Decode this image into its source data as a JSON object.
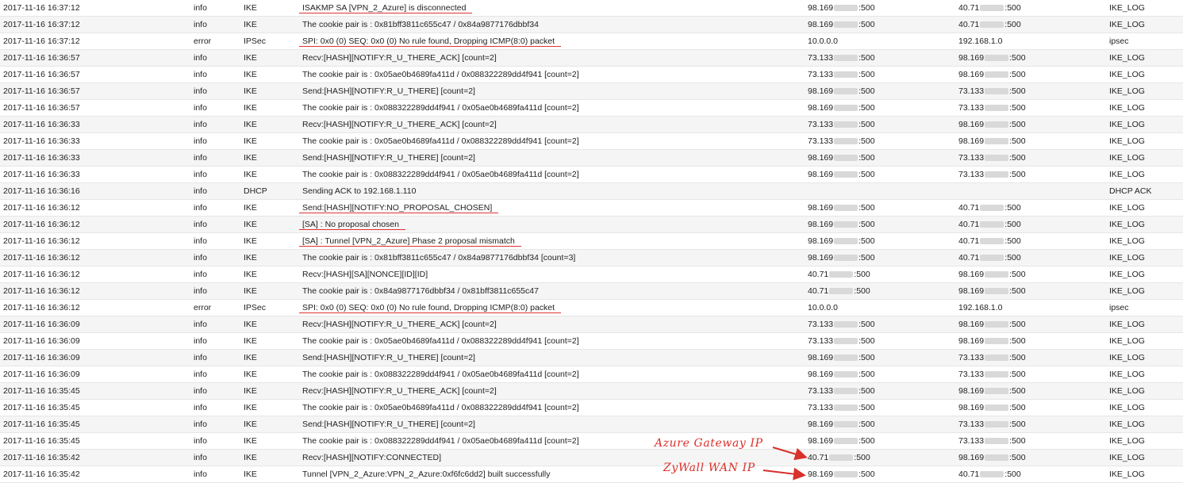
{
  "colors": {
    "annotation": "#d9302b",
    "row_alt": "#f5f5f5",
    "text": "#222222"
  },
  "rows": [
    {
      "time": "2017-11-16 16:37:12",
      "priority": "info",
      "category": "IKE",
      "message": "ISAKMP SA [VPN_2_Azure] is disconnected",
      "src": [
        "98.169",
        "",
        ":500"
      ],
      "dst": [
        "40.71",
        "",
        ":500"
      ],
      "note": "IKE_LOG",
      "underlined": true
    },
    {
      "time": "2017-11-16 16:37:12",
      "priority": "info",
      "category": "IKE",
      "message": "The cookie pair is : 0x81bff3811c655c47 / 0x84a9877176dbbf34",
      "src": [
        "98.169",
        "",
        ":500"
      ],
      "dst": [
        "40.71",
        "",
        ":500"
      ],
      "note": "IKE_LOG",
      "underlined": false
    },
    {
      "time": "2017-11-16 16:37:12",
      "priority": "error",
      "category": "IPSec",
      "message": "SPI: 0x0 (0) SEQ: 0x0 (0) No rule found, Dropping ICMP(8:0) packet",
      "src": [
        "10.0.0.0",
        "",
        ""
      ],
      "dst": [
        "192.168.1.0",
        "",
        ""
      ],
      "note": "ipsec",
      "underlined": true
    },
    {
      "time": "2017-11-16 16:36:57",
      "priority": "info",
      "category": "IKE",
      "message": "Recv:[HASH][NOTIFY:R_U_THERE_ACK] [count=2]",
      "src": [
        "73.133",
        "",
        ":500"
      ],
      "dst": [
        "98.169",
        "",
        ":500"
      ],
      "note": "IKE_LOG",
      "underlined": false
    },
    {
      "time": "2017-11-16 16:36:57",
      "priority": "info",
      "category": "IKE",
      "message": "The cookie pair is : 0x05ae0b4689fa411d / 0x088322289dd4f941 [count=2]",
      "src": [
        "73.133",
        "",
        ":500"
      ],
      "dst": [
        "98.169",
        "",
        ":500"
      ],
      "note": "IKE_LOG",
      "underlined": false
    },
    {
      "time": "2017-11-16 16:36:57",
      "priority": "info",
      "category": "IKE",
      "message": "Send:[HASH][NOTIFY:R_U_THERE] [count=2]",
      "src": [
        "98.169",
        "",
        ":500"
      ],
      "dst": [
        "73.133",
        "",
        ":500"
      ],
      "note": "IKE_LOG",
      "underlined": false
    },
    {
      "time": "2017-11-16 16:36:57",
      "priority": "info",
      "category": "IKE",
      "message": "The cookie pair is : 0x088322289dd4f941 / 0x05ae0b4689fa411d [count=2]",
      "src": [
        "98.169",
        "",
        ":500"
      ],
      "dst": [
        "73.133",
        "",
        ":500"
      ],
      "note": "IKE_LOG",
      "underlined": false
    },
    {
      "time": "2017-11-16 16:36:33",
      "priority": "info",
      "category": "IKE",
      "message": "Recv:[HASH][NOTIFY:R_U_THERE_ACK] [count=2]",
      "src": [
        "73.133",
        "",
        ":500"
      ],
      "dst": [
        "98.169",
        "",
        ":500"
      ],
      "note": "IKE_LOG",
      "underlined": false
    },
    {
      "time": "2017-11-16 16:36:33",
      "priority": "info",
      "category": "IKE",
      "message": "The cookie pair is : 0x05ae0b4689fa411d / 0x088322289dd4f941 [count=2]",
      "src": [
        "73.133",
        "",
        ":500"
      ],
      "dst": [
        "98.169",
        "",
        ":500"
      ],
      "note": "IKE_LOG",
      "underlined": false
    },
    {
      "time": "2017-11-16 16:36:33",
      "priority": "info",
      "category": "IKE",
      "message": "Send:[HASH][NOTIFY:R_U_THERE] [count=2]",
      "src": [
        "98.169",
        "",
        ":500"
      ],
      "dst": [
        "73.133",
        "",
        ":500"
      ],
      "note": "IKE_LOG",
      "underlined": false
    },
    {
      "time": "2017-11-16 16:36:33",
      "priority": "info",
      "category": "IKE",
      "message": "The cookie pair is : 0x088322289dd4f941 / 0x05ae0b4689fa411d [count=2]",
      "src": [
        "98.169",
        "",
        ":500"
      ],
      "dst": [
        "73.133",
        "",
        ":500"
      ],
      "note": "IKE_LOG",
      "underlined": false
    },
    {
      "time": "2017-11-16 16:36:16",
      "priority": "info",
      "category": "DHCP",
      "message": "Sending ACK to 192.168.1.110",
      "src": [
        "",
        "",
        ""
      ],
      "dst": [
        "",
        "",
        ""
      ],
      "note": "DHCP ACK",
      "underlined": false
    },
    {
      "time": "2017-11-16 16:36:12",
      "priority": "info",
      "category": "IKE",
      "message": "Send:[HASH][NOTIFY:NO_PROPOSAL_CHOSEN]",
      "src": [
        "98.169",
        "",
        ":500"
      ],
      "dst": [
        "40.71",
        "",
        ":500"
      ],
      "note": "IKE_LOG",
      "underlined": true
    },
    {
      "time": "2017-11-16 16:36:12",
      "priority": "info",
      "category": "IKE",
      "message": "[SA] : No proposal chosen",
      "src": [
        "98.169",
        "",
        ":500"
      ],
      "dst": [
        "40.71",
        "",
        ":500"
      ],
      "note": "IKE_LOG",
      "underlined": true
    },
    {
      "time": "2017-11-16 16:36:12",
      "priority": "info",
      "category": "IKE",
      "message": "[SA] : Tunnel [VPN_2_Azure] Phase 2 proposal mismatch",
      "src": [
        "98.169",
        "",
        ":500"
      ],
      "dst": [
        "40.71",
        "",
        ":500"
      ],
      "note": "IKE_LOG",
      "underlined": true
    },
    {
      "time": "2017-11-16 16:36:12",
      "priority": "info",
      "category": "IKE",
      "message": "The cookie pair is : 0x81bff3811c655c47 / 0x84a9877176dbbf34 [count=3]",
      "src": [
        "98.169",
        "",
        ":500"
      ],
      "dst": [
        "40.71",
        "",
        ":500"
      ],
      "note": "IKE_LOG",
      "underlined": false
    },
    {
      "time": "2017-11-16 16:36:12",
      "priority": "info",
      "category": "IKE",
      "message": "Recv:[HASH][SA][NONCE][ID][ID]",
      "src": [
        "40.71",
        "",
        ":500"
      ],
      "dst": [
        "98.169",
        "",
        ":500"
      ],
      "note": "IKE_LOG",
      "underlined": false
    },
    {
      "time": "2017-11-16 16:36:12",
      "priority": "info",
      "category": "IKE",
      "message": "The cookie pair is : 0x84a9877176dbbf34 / 0x81bff3811c655c47",
      "src": [
        "40.71",
        "",
        ":500"
      ],
      "dst": [
        "98.169",
        "",
        ":500"
      ],
      "note": "IKE_LOG",
      "underlined": false
    },
    {
      "time": "2017-11-16 16:36:12",
      "priority": "error",
      "category": "IPSec",
      "message": "SPI: 0x0 (0) SEQ: 0x0 (0) No rule found, Dropping ICMP(8:0) packet",
      "src": [
        "10.0.0.0",
        "",
        ""
      ],
      "dst": [
        "192.168.1.0",
        "",
        ""
      ],
      "note": "ipsec",
      "underlined": true
    },
    {
      "time": "2017-11-16 16:36:09",
      "priority": "info",
      "category": "IKE",
      "message": "Recv:[HASH][NOTIFY:R_U_THERE_ACK] [count=2]",
      "src": [
        "73.133",
        "",
        ":500"
      ],
      "dst": [
        "98.169",
        "",
        ":500"
      ],
      "note": "IKE_LOG",
      "underlined": false
    },
    {
      "time": "2017-11-16 16:36:09",
      "priority": "info",
      "category": "IKE",
      "message": "The cookie pair is : 0x05ae0b4689fa411d / 0x088322289dd4f941 [count=2]",
      "src": [
        "73.133",
        "",
        ":500"
      ],
      "dst": [
        "98.169",
        "",
        ":500"
      ],
      "note": "IKE_LOG",
      "underlined": false
    },
    {
      "time": "2017-11-16 16:36:09",
      "priority": "info",
      "category": "IKE",
      "message": "Send:[HASH][NOTIFY:R_U_THERE] [count=2]",
      "src": [
        "98.169",
        "",
        ":500"
      ],
      "dst": [
        "73.133",
        "",
        ":500"
      ],
      "note": "IKE_LOG",
      "underlined": false
    },
    {
      "time": "2017-11-16 16:36:09",
      "priority": "info",
      "category": "IKE",
      "message": "The cookie pair is : 0x088322289dd4f941 / 0x05ae0b4689fa411d [count=2]",
      "src": [
        "98.169",
        "",
        ":500"
      ],
      "dst": [
        "73.133",
        "",
        ":500"
      ],
      "note": "IKE_LOG",
      "underlined": false
    },
    {
      "time": "2017-11-16 16:35:45",
      "priority": "info",
      "category": "IKE",
      "message": "Recv:[HASH][NOTIFY:R_U_THERE_ACK] [count=2]",
      "src": [
        "73.133",
        "",
        ":500"
      ],
      "dst": [
        "98.169",
        "",
        ":500"
      ],
      "note": "IKE_LOG",
      "underlined": false
    },
    {
      "time": "2017-11-16 16:35:45",
      "priority": "info",
      "category": "IKE",
      "message": "The cookie pair is : 0x05ae0b4689fa411d / 0x088322289dd4f941 [count=2]",
      "src": [
        "73.133",
        "",
        ":500"
      ],
      "dst": [
        "98.169",
        "",
        ":500"
      ],
      "note": "IKE_LOG",
      "underlined": false
    },
    {
      "time": "2017-11-16 16:35:45",
      "priority": "info",
      "category": "IKE",
      "message": "Send:[HASH][NOTIFY:R_U_THERE] [count=2]",
      "src": [
        "98.169",
        "",
        ":500"
      ],
      "dst": [
        "73.133",
        "",
        ":500"
      ],
      "note": "IKE_LOG",
      "underlined": false
    },
    {
      "time": "2017-11-16 16:35:45",
      "priority": "info",
      "category": "IKE",
      "message": "The cookie pair is : 0x088322289dd4f941 / 0x05ae0b4689fa411d [count=2]",
      "src": [
        "98.169",
        "",
        ":500"
      ],
      "dst": [
        "73.133",
        "",
        ":500"
      ],
      "note": "IKE_LOG",
      "underlined": false
    },
    {
      "time": "2017-11-16 16:35:42",
      "priority": "info",
      "category": "IKE",
      "message": "Recv:[HASH][NOTIFY:CONNECTED]",
      "src": [
        "40.71",
        "",
        ":500"
      ],
      "dst": [
        "98.169",
        "",
        ":500"
      ],
      "note": "IKE_LOG",
      "underlined": false
    },
    {
      "time": "2017-11-16 16:35:42",
      "priority": "info",
      "category": "IKE",
      "message": "Tunnel [VPN_2_Azure:VPN_2_Azure:0xf6fc6dd2] built successfully",
      "src": [
        "98.169",
        "",
        ":500"
      ],
      "dst": [
        "40.71",
        "",
        ":500"
      ],
      "note": "IKE_LOG",
      "underlined": false
    }
  ],
  "annotations": {
    "azure_gateway": "Azure Gateway IP",
    "zywall_wan": "ZyWall WAN IP"
  }
}
